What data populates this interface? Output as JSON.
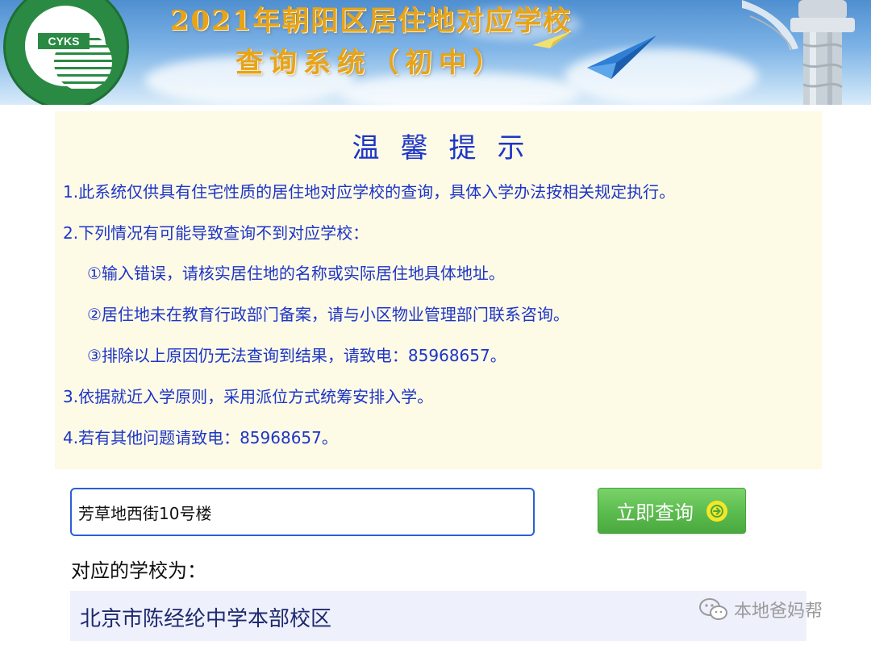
{
  "banner": {
    "logo_text": "CYKS",
    "title_line1": "2021年朝阳区居住地对应学校",
    "title_line2": "查询系统（初中）"
  },
  "tips": {
    "title": "温馨提示",
    "items": [
      "1.此系统仅供具有住宅性质的居住地对应学校的查询，具体入学办法按相关规定执行。",
      "2.下列情况有可能导致查询不到对应学校：",
      "①输入错误，请核实居住地的名称或实际居住地具体地址。",
      "②居住地未在教育行政部门备案，请与小区物业管理部门联系咨询。",
      "③排除以上原因仍无法查询到结果，请致电：85968657。",
      "3.依据就近入学原则，采用派位方式统筹安排入学。",
      "4.若有其他问题请致电：85968657。"
    ]
  },
  "search": {
    "value": "芳草地西街10号楼",
    "button_label": "立即查询",
    "button_icon": "arrow-right-circle-icon"
  },
  "result": {
    "label": "对应的学校为：",
    "school": "北京市陈经纶中学本部校区"
  },
  "watermark": {
    "text": "本地爸妈帮",
    "icon": "wechat-icon"
  },
  "colors": {
    "tips_text": "#1d35c8",
    "tips_bg": "#fdfae6",
    "button_green": "#5bbb4e",
    "input_border": "#2b5fd4",
    "result_bg": "#eef0fb",
    "banner_title": "#e8a317"
  }
}
